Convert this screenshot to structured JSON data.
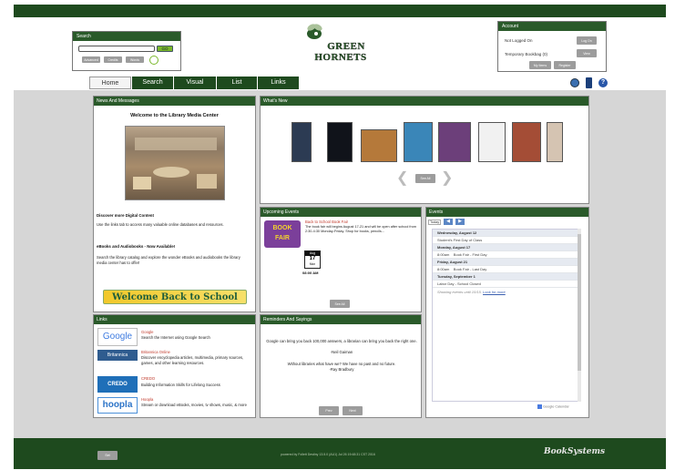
{
  "search": {
    "title": "Search",
    "placeholder": "",
    "go_label": "GO",
    "buttons": [
      "Advanced",
      "Credits",
      "Words"
    ]
  },
  "brand": {
    "line1": "GREEN",
    "line2": "HORNETS"
  },
  "account": {
    "title": "Account",
    "status": "Not Logged On",
    "login_label": "Log On",
    "bookbag": "Temporary Bookbag (0)",
    "view_label": "View",
    "my_items_label": "My Items",
    "register_label": "Register"
  },
  "tabs": [
    "Home",
    "Search",
    "Visual",
    "List",
    "Links"
  ],
  "news": {
    "title": "News And Messages",
    "heading": "Welcome to the Library Media Center",
    "h1": "Discover more Digital Content",
    "p1": "Use the links tab to access many valuable online databases and resources.",
    "h2": "eBooks and Audiobooks - Now Available!",
    "p2": "Search the library catalog and explore the wonder eBooks and audiobooks the library media center has to offer!",
    "banner": "Welcome Back to School"
  },
  "whatsnew": {
    "title": "What's New",
    "see_all": "See All"
  },
  "upcoming": {
    "title": "Upcoming Events",
    "event_title": "Back to School Book Fair",
    "event_desc": "The book fair will begins August 17-21 and will be open after school from 2:30-4:30 Monday-Friday. Shop for books, pencils...",
    "cal_month": "Aug",
    "cal_day": "17",
    "cal_dow": "Mon",
    "time": "08:00 AM",
    "see_all": "See All",
    "logo1": "BOOK",
    "logo2": "FAIR"
  },
  "events": {
    "title": "Events",
    "today": "Today",
    "rows": [
      {
        "day": "Wednesday, August 12"
      },
      {
        "time": "",
        "text": "Student's First Day of Class"
      },
      {
        "day": "Monday, August 17"
      },
      {
        "time": "8:00am",
        "text": "Book Fair - First Day"
      },
      {
        "day": "Friday, August 21"
      },
      {
        "time": "8:00am",
        "text": "Book Fair - Last Day"
      },
      {
        "day": "Tuesday, September 1"
      },
      {
        "time": "",
        "text": "Labor Day - School Closed"
      }
    ],
    "footnote": "Showing events until 10/15.",
    "look_more": "Look for more",
    "gcal": "Google Calendar"
  },
  "links": {
    "title": "Links",
    "items": [
      {
        "logo": "Google",
        "name": "Google",
        "desc": "Search the Internet using Google Search"
      },
      {
        "logo": "Britannica",
        "name": "Britannica Online",
        "desc": "Discover encyclopedia articles, multimedia, primary sources, games, and other learning resources."
      },
      {
        "logo": "CREDO",
        "name": "CREDO",
        "desc": "Building Information Skills for Lifelong Success"
      },
      {
        "logo": "hoopla",
        "name": "Hoopla",
        "desc": "Stream or download eBooks, movies, tv shows, music, & more"
      }
    ]
  },
  "reminders": {
    "title": "Reminders And Sayings",
    "quote1": "Google can bring you back 100,000 answers, a librarian can bring you back the right one.",
    "author1": "-Neil Gaiman",
    "quote2": "Without libraries what have we? We have no past and no future.",
    "author2": "-Ray Bradbury",
    "prev": "Prev",
    "next": "Next"
  },
  "footer": {
    "button": "Set",
    "powered": "powered by Follett Destiny 13.5.0 (AU1) Jul 26 19:48:31 CST 2016",
    "logo": "BookSystems"
  },
  "colors": {
    "dark_green": "#1e4a1e",
    "panel_header": "#2a5a2a",
    "go_green": "#7ab82b"
  }
}
